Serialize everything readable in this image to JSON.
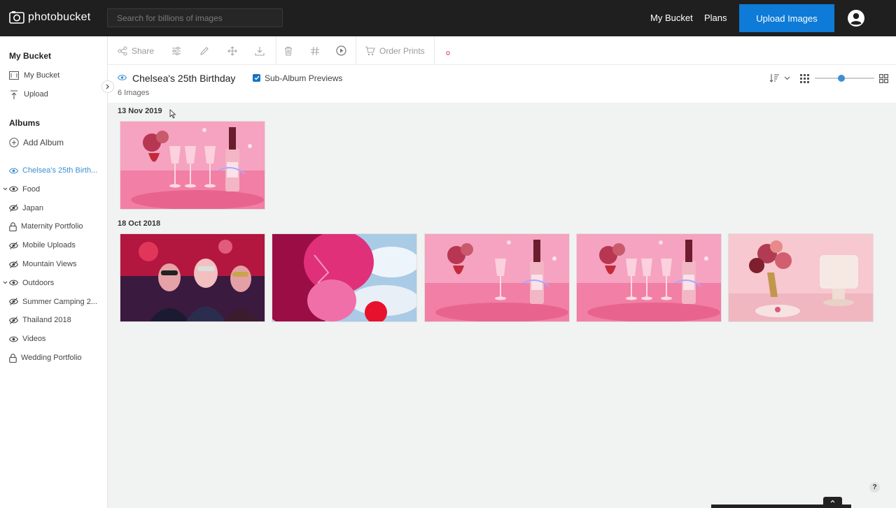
{
  "header": {
    "logo_text": "photobucket",
    "search_placeholder": "Search for billions of images",
    "nav": [
      "My Bucket",
      "Plans"
    ],
    "upload_label": "Upload Images"
  },
  "sidebar": {
    "my_bucket_heading": "My Bucket",
    "my_bucket_items": [
      {
        "label": "My Bucket",
        "icon": "photo-icon"
      },
      {
        "label": "Upload",
        "icon": "upload-icon"
      }
    ],
    "albums_heading": "Albums",
    "add_album_label": "Add Album",
    "albums": [
      {
        "label": "Chelsea's 25th Birth...",
        "icon": "eye-icon",
        "active": true
      },
      {
        "label": "Food",
        "icon": "eye-icon",
        "expandable": true
      },
      {
        "label": "Japan",
        "icon": "eye-slash-icon"
      },
      {
        "label": "Maternity Portfolio",
        "icon": "lock-icon"
      },
      {
        "label": "Mobile Uploads",
        "icon": "eye-slash-icon"
      },
      {
        "label": "Mountain Views",
        "icon": "eye-slash-icon"
      },
      {
        "label": "Outdoors",
        "icon": "eye-icon",
        "expandable": true
      },
      {
        "label": "Summer Camping 2...",
        "icon": "eye-slash-icon"
      },
      {
        "label": "Thailand 2018",
        "icon": "eye-slash-icon"
      },
      {
        "label": "Videos",
        "icon": "eye-icon"
      },
      {
        "label": "Wedding Portfolio",
        "icon": "lock-icon"
      }
    ]
  },
  "toolbar": {
    "share_label": "Share",
    "order_prints_label": "Order Prints",
    "icons": [
      "share-icon",
      "adjust-icon",
      "edit-icon",
      "move-icon",
      "download-icon",
      "delete-icon",
      "hashtag-icon",
      "slideshow-icon",
      "cart-icon"
    ]
  },
  "album": {
    "title": "Chelsea's 25th Birthday",
    "sub_album_label": "Sub-Album Previews",
    "sub_album_checked": true,
    "image_count": "6 Images",
    "zoom_level": 0.45
  },
  "groups": [
    {
      "date": "13 Nov 2019",
      "images": [
        {
          "scene": "wine-bottle-glasses"
        }
      ]
    },
    {
      "date": "18 Oct 2018",
      "images": [
        {
          "scene": "party-masks"
        },
        {
          "scene": "pink-balloons"
        },
        {
          "scene": "wine-bottle-glass"
        },
        {
          "scene": "wine-bottle-glasses"
        },
        {
          "scene": "flowers-cake"
        }
      ]
    }
  ],
  "help_label": "?",
  "colors": {
    "accent": "#0d7bd7",
    "topbar": "#1f1f1f",
    "active_link": "#3d8fd1"
  }
}
